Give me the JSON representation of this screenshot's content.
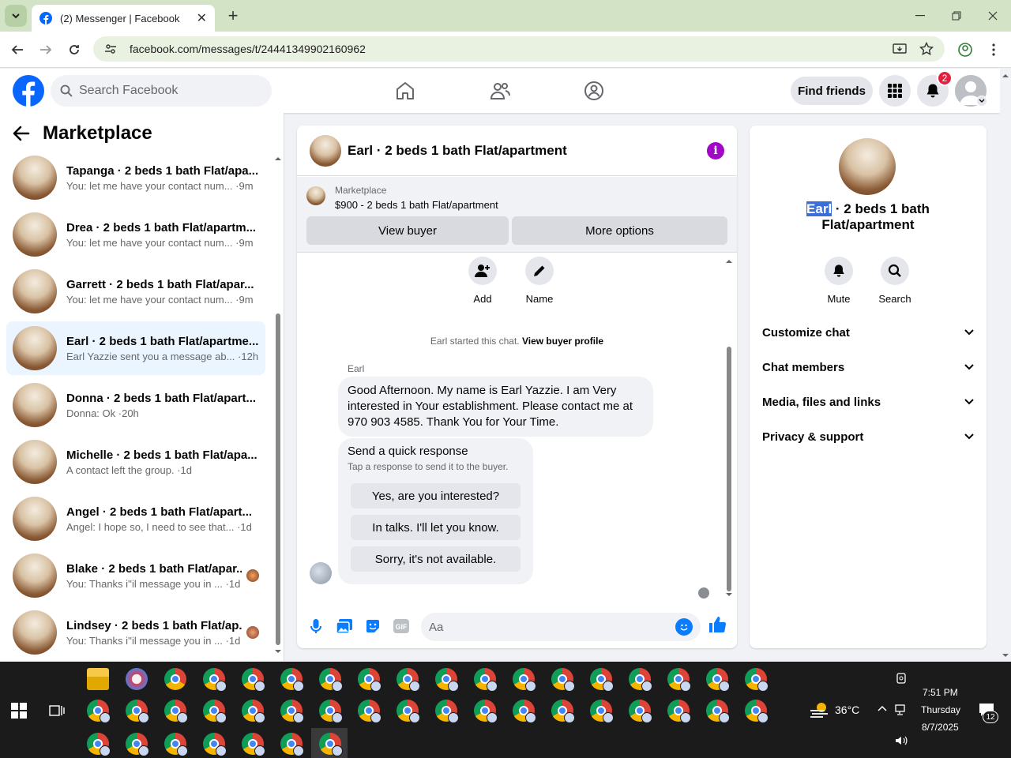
{
  "browser": {
    "tab_title": "(2) Messenger | Facebook",
    "url": "facebook.com/messages/t/24441349902160962"
  },
  "fb": {
    "search_placeholder": "Search Facebook",
    "find_friends": "Find friends",
    "notification_count": "2"
  },
  "sidebar": {
    "title": "Marketplace",
    "conversations": [
      {
        "name": "Tapanga · 2 beds 1 bath Flat/apa...",
        "preview": "You: let me have your contact num... ·9m"
      },
      {
        "name": "Drea · 2 beds 1 bath Flat/apartm...",
        "preview": "You: let me have your contact num... ·9m"
      },
      {
        "name": "Garrett · 2 beds 1 bath Flat/apar...",
        "preview": "You: let me have your contact num... ·9m"
      },
      {
        "name": "Earl · 2 beds 1 bath Flat/apartme...",
        "preview": "Earl Yazzie sent you a message ab... ·12h"
      },
      {
        "name": "Donna · 2 beds 1 bath Flat/apart...",
        "preview": "Donna: Ok ·20h"
      },
      {
        "name": "Michelle · 2 beds 1 bath Flat/apa...",
        "preview": "A contact left the group. ·1d"
      },
      {
        "name": "Angel · 2 beds 1 bath Flat/apart...",
        "preview": "Angel: I hope so, I need to see that... ·1d"
      },
      {
        "name": "Blake · 2 beds 1 bath Flat/apar...",
        "preview": "You: Thanks i''il message you in ... ·1d"
      },
      {
        "name": "Lindsey · 2 beds 1 bath Flat/ap...",
        "preview": "You: Thanks i''il message you in ... ·1d"
      }
    ]
  },
  "chat": {
    "title": "Earl · 2 beds 1 bath Flat/apartment",
    "marketplace_label": "Marketplace",
    "listing": "$900 - 2 beds 1 bath Flat/apartment",
    "view_buyer": "View buyer",
    "more_options": "More options",
    "add_label": "Add",
    "name_label": "Name",
    "started_prefix": "Earl started this chat.",
    "view_buyer_profile": "View buyer profile",
    "sender": "Earl",
    "message": "Good Afternoon. My name is Earl Yazzie. I am Very interested in Your establishment. Please contact me at 970 903 4585. Thank You for Your Time.",
    "quick_title": "Send a quick response",
    "quick_sub": "Tap a response to send it to the buyer.",
    "quick_replies": [
      "Yes, are you interested?",
      "In talks. I'll let you know.",
      "Sorry, it's not available."
    ],
    "composer_placeholder": "Aa"
  },
  "details": {
    "name_highlight": "Earl",
    "name_rest": " · 2 beds 1 bath Flat/apartment",
    "mute": "Mute",
    "search": "Search",
    "sections": [
      "Customize chat",
      "Chat members",
      "Media, files and links",
      "Privacy & support"
    ]
  },
  "taskbar": {
    "temperature": "36°C",
    "time": "7:51 PM",
    "day": "Thursday",
    "date": "8/7/2025",
    "notif_count": "12"
  },
  "colors": {
    "fb_blue": "#0866ff",
    "messenger_purple": "#a007c7",
    "active_row": "#ebf5ff",
    "tab_strip": "#d3e3c6",
    "badge_red": "#e41e3f"
  }
}
